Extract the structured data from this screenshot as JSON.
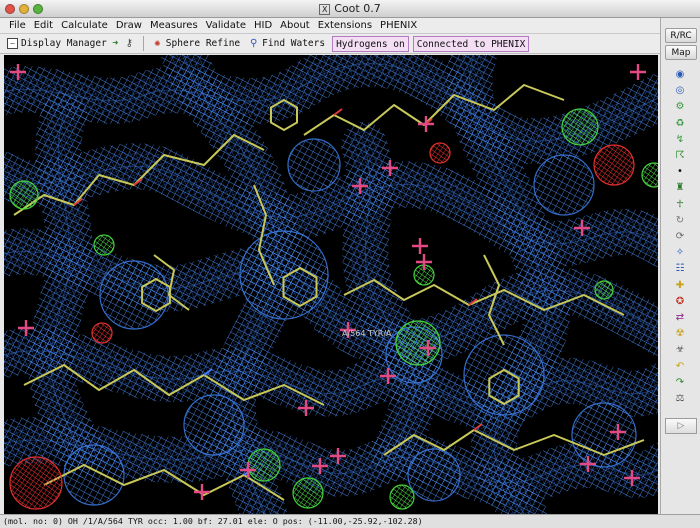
{
  "window": {
    "title": "Coot 0.7"
  },
  "menubar": {
    "items": [
      "File",
      "Edit",
      "Calculate",
      "Draw",
      "Measures",
      "Validate",
      "HID",
      "About",
      "Extensions",
      "PHENIX"
    ]
  },
  "toolbar": {
    "display_manager": "Display Manager",
    "sphere_refine": "Sphere Refine",
    "find_waters": "Find Waters",
    "hydrogens": "Hydrogens on",
    "phenix_status": "Connected to PHENIX"
  },
  "sidebar": {
    "rrc": "R/RC",
    "map": "Map",
    "icons": [
      "rotate-translate-icon",
      "refine-icon",
      "regularize-icon",
      "rigid-body-icon",
      "flip-icon",
      "backbone-icon",
      "dot-icon",
      "rotamer-icon",
      "mutate-icon",
      "edit-chi-icon",
      "torsion-icon",
      "pep-flip-icon",
      "base-pair-icon",
      "add-atom-icon",
      "auto-fit-icon",
      "cis-trans-icon",
      "ligand-icon",
      "delete-icon",
      "undo-icon",
      "redo-icon",
      "measure-icon"
    ],
    "bottom_arrow": "▷"
  },
  "viewport": {
    "residue_label": "A/564 TYR/A",
    "colors": {
      "background": "#000000",
      "map": "#3a78e0",
      "model": "#c8c85a",
      "positive_diff": "#44d23c",
      "negative_diff": "#e03030",
      "water": "#e34a84"
    }
  },
  "statusbar": {
    "text": "(mol. no: 0) OH /1/A/564 TYR occ: 1.00 bf: 27.01 ele: O pos: (-11.00,-25.92,-102.28)"
  }
}
